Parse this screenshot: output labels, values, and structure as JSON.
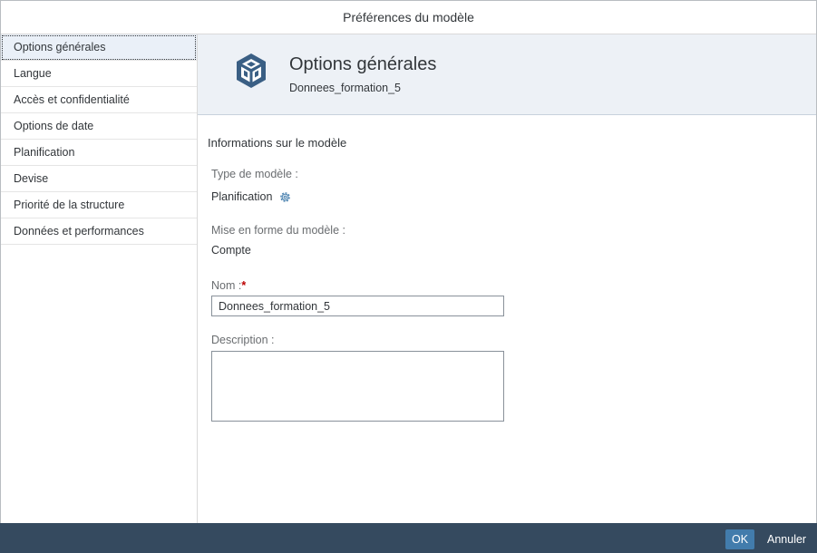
{
  "dialog": {
    "title": "Préférences du modèle"
  },
  "sidebar": {
    "items": [
      {
        "label": "Options générales",
        "selected": true
      },
      {
        "label": "Langue",
        "selected": false
      },
      {
        "label": "Accès et confidentialité",
        "selected": false
      },
      {
        "label": "Options de date",
        "selected": false
      },
      {
        "label": "Planification",
        "selected": false
      },
      {
        "label": "Devise",
        "selected": false
      },
      {
        "label": "Priorité de la structure",
        "selected": false
      },
      {
        "label": "Données et performances",
        "selected": false
      }
    ]
  },
  "header": {
    "title": "Options générales",
    "subtitle": "Donnees_formation_5",
    "icon": "model-cube-icon"
  },
  "form": {
    "section_title": "Informations sur le modèle",
    "model_type_label": "Type de modèle :",
    "model_type_value": "Planification",
    "model_format_label": "Mise en forme du modèle :",
    "model_format_value": "Compte",
    "name_label": "Nom :",
    "name_required_mark": "*",
    "name_value": "Donnees_formation_5",
    "description_label": "Description :",
    "description_value": ""
  },
  "footer": {
    "ok_label": "OK",
    "cancel_label": "Annuler"
  },
  "colors": {
    "accent": "#427cac",
    "footer_bg": "#354a5f",
    "header_bg": "#edf1f6",
    "icon": "#3a5f84",
    "required": "#bb0000"
  }
}
